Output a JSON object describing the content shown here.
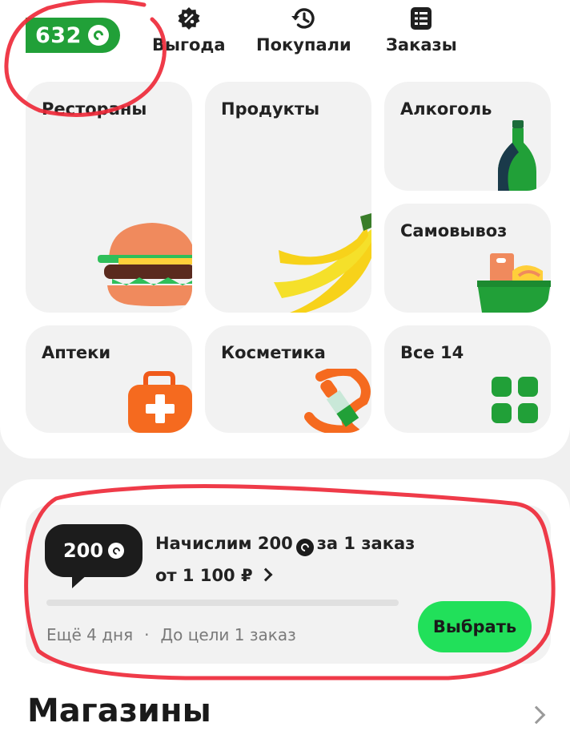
{
  "header": {
    "balance": "632",
    "nav": [
      {
        "label": "Выгода",
        "icon": "percent-badge-icon"
      },
      {
        "label": "Покупали",
        "icon": "history-icon"
      },
      {
        "label": "Заказы",
        "icon": "list-icon"
      }
    ]
  },
  "categories": [
    {
      "label": "Рестораны",
      "icon": "burger-icon"
    },
    {
      "label": "Продукты",
      "icon": "banana-icon"
    },
    {
      "label": "Алкоголь",
      "icon": "bottle-icon"
    },
    {
      "label": "Самовывоз",
      "icon": "basket-icon"
    },
    {
      "label": "Аптеки",
      "icon": "first-aid-kit-icon"
    },
    {
      "label": "Косметика",
      "icon": "lipstick-icon"
    },
    {
      "label": "Все 14",
      "icon": "grid-icon"
    }
  ],
  "promo": {
    "bubble_amount": "200",
    "line1_prefix": "Начислим 200",
    "line1_suffix": "за 1 заказ",
    "line2": "от 1 100 ₽",
    "progress": 0,
    "days_left": "Ещё 4 дня",
    "goal": "До цели 1 заказ",
    "button": "Выбрать"
  },
  "section": {
    "title": "Магазины"
  },
  "colors": {
    "brand_green": "#21a038",
    "button_green": "#21e05a",
    "annotation_red": "#ee2a3a"
  }
}
